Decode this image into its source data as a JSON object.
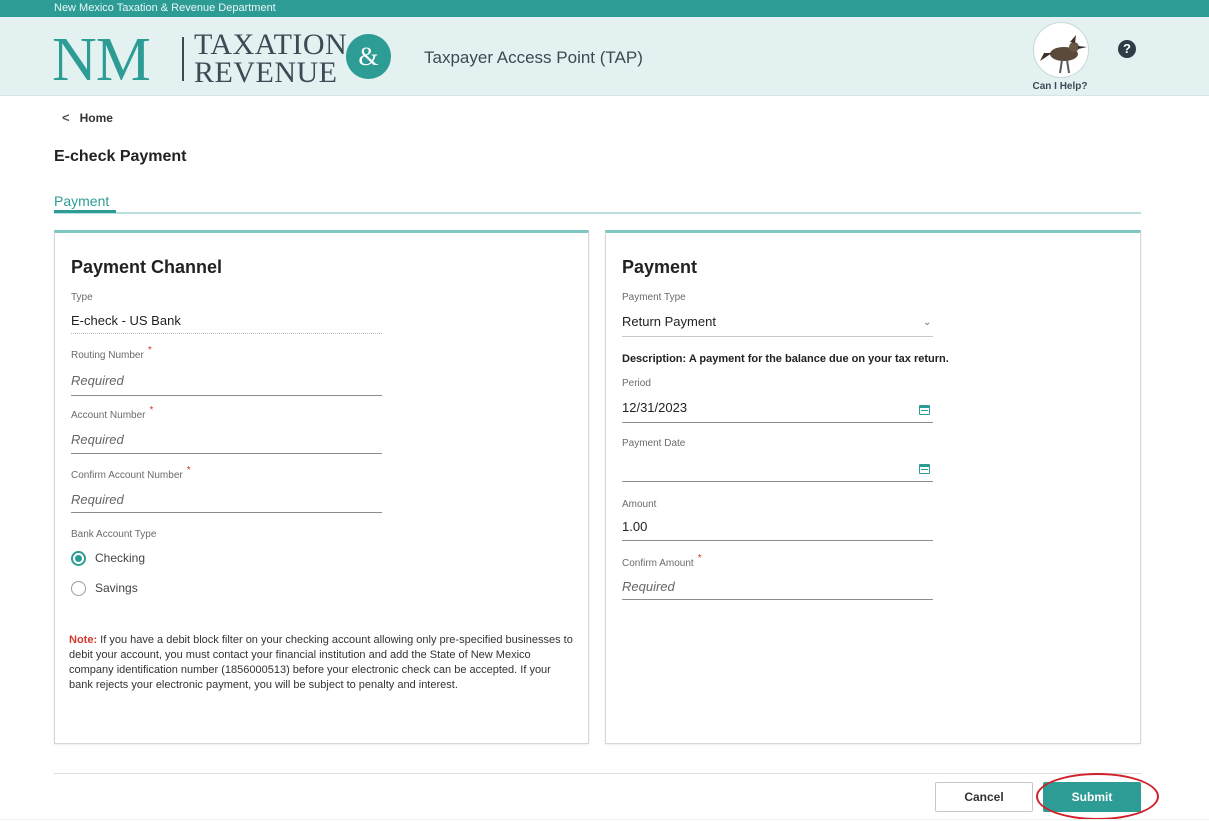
{
  "header": {
    "agency_line": "New Mexico Taxation & Revenue Department",
    "logo_nm": "NM",
    "logo_line1": "TAXATION",
    "logo_line2": "REVENUE",
    "logo_amp": "&",
    "app_title": "Taxpayer Access Point (TAP)",
    "help_label": "Can I Help?",
    "help_icon_glyph": "?",
    "brand_color": "#2c9c95"
  },
  "nav": {
    "home_label": "Home",
    "back_icon_glyph": "<"
  },
  "page": {
    "title": "E-check Payment",
    "tab_label": "Payment"
  },
  "payment_channel": {
    "title": "Payment Channel",
    "type_label": "Type",
    "type_value": "E-check - US Bank",
    "routing_label": "Routing Number",
    "routing_placeholder": "Required",
    "account_label": "Account Number",
    "account_placeholder": "Required",
    "confirm_account_label": "Confirm Account Number",
    "confirm_account_placeholder": "Required",
    "bank_type_label": "Bank Account Type",
    "bank_type_options": [
      "Checking",
      "Savings"
    ],
    "bank_type_selected": "Checking",
    "required_marker": "*",
    "note_label": "Note:",
    "note_text": " If you have a debit block filter on your checking account allowing only pre-specified businesses to debit your account, you must contact your financial institution and add the State of New Mexico company identification number (1856000513) before your electronic check can be accepted. If your bank rejects your electronic payment, you will be subject to penalty and interest."
  },
  "payment": {
    "title": "Payment",
    "payment_type_label": "Payment Type",
    "payment_type_value": "Return Payment",
    "description": "Description: A payment for the balance due on your tax return.",
    "period_label": "Period",
    "period_value": "12/31/2023",
    "payment_date_label": "Payment Date",
    "payment_date_value": "",
    "amount_label": "Amount",
    "amount_value": "1.00",
    "confirm_amount_label": "Confirm Amount",
    "confirm_amount_placeholder": "Required",
    "required_marker": "*"
  },
  "actions": {
    "cancel_label": "Cancel",
    "submit_label": "Submit"
  }
}
